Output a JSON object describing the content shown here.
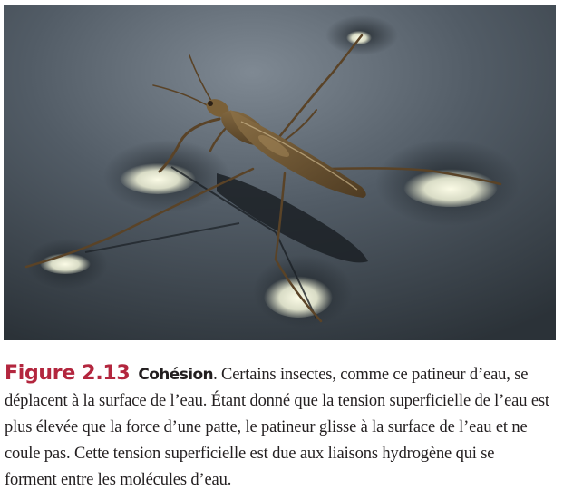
{
  "figure": {
    "label": "Figure 2.13",
    "title": "Cohésion",
    "lines": [
      ". Certains insectes, comme ce patineur d’eau, se",
      "déplacent à la surface de l’eau. Étant donné que la tension superficielle de l’eau est",
      "plus élevée que la force d’une patte, le patineur glisse à la surface de l’eau et ne",
      "coule pas. Cette tension superficielle est due aux liaisons hydrogène qui se",
      "forment entre les molécules d’eau."
    ]
  },
  "colors": {
    "figure_label": "#b3263e",
    "text": "#231f20",
    "water_dark": "#2f363d",
    "water_light": "#6b7681",
    "insect": "#6e5632"
  }
}
